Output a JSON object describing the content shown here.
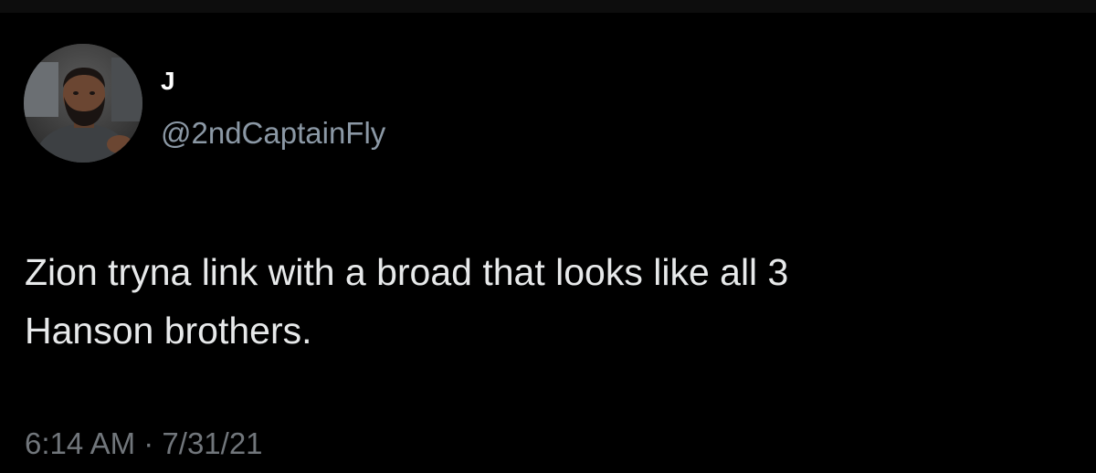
{
  "tweet": {
    "author": {
      "display_name": "J",
      "handle": "@2ndCaptainFly",
      "avatar_icon": "profile-photo"
    },
    "text_line_1": "Zion tryna link with a broad that looks like all 3",
    "text_line_2": "Hanson brothers.",
    "time": "6:14 AM",
    "separator": "·",
    "date": "7/31/21"
  },
  "colors": {
    "background": "#000000",
    "text": "#e7e9ea",
    "handle": "#8b98a5",
    "meta": "#71767b"
  }
}
